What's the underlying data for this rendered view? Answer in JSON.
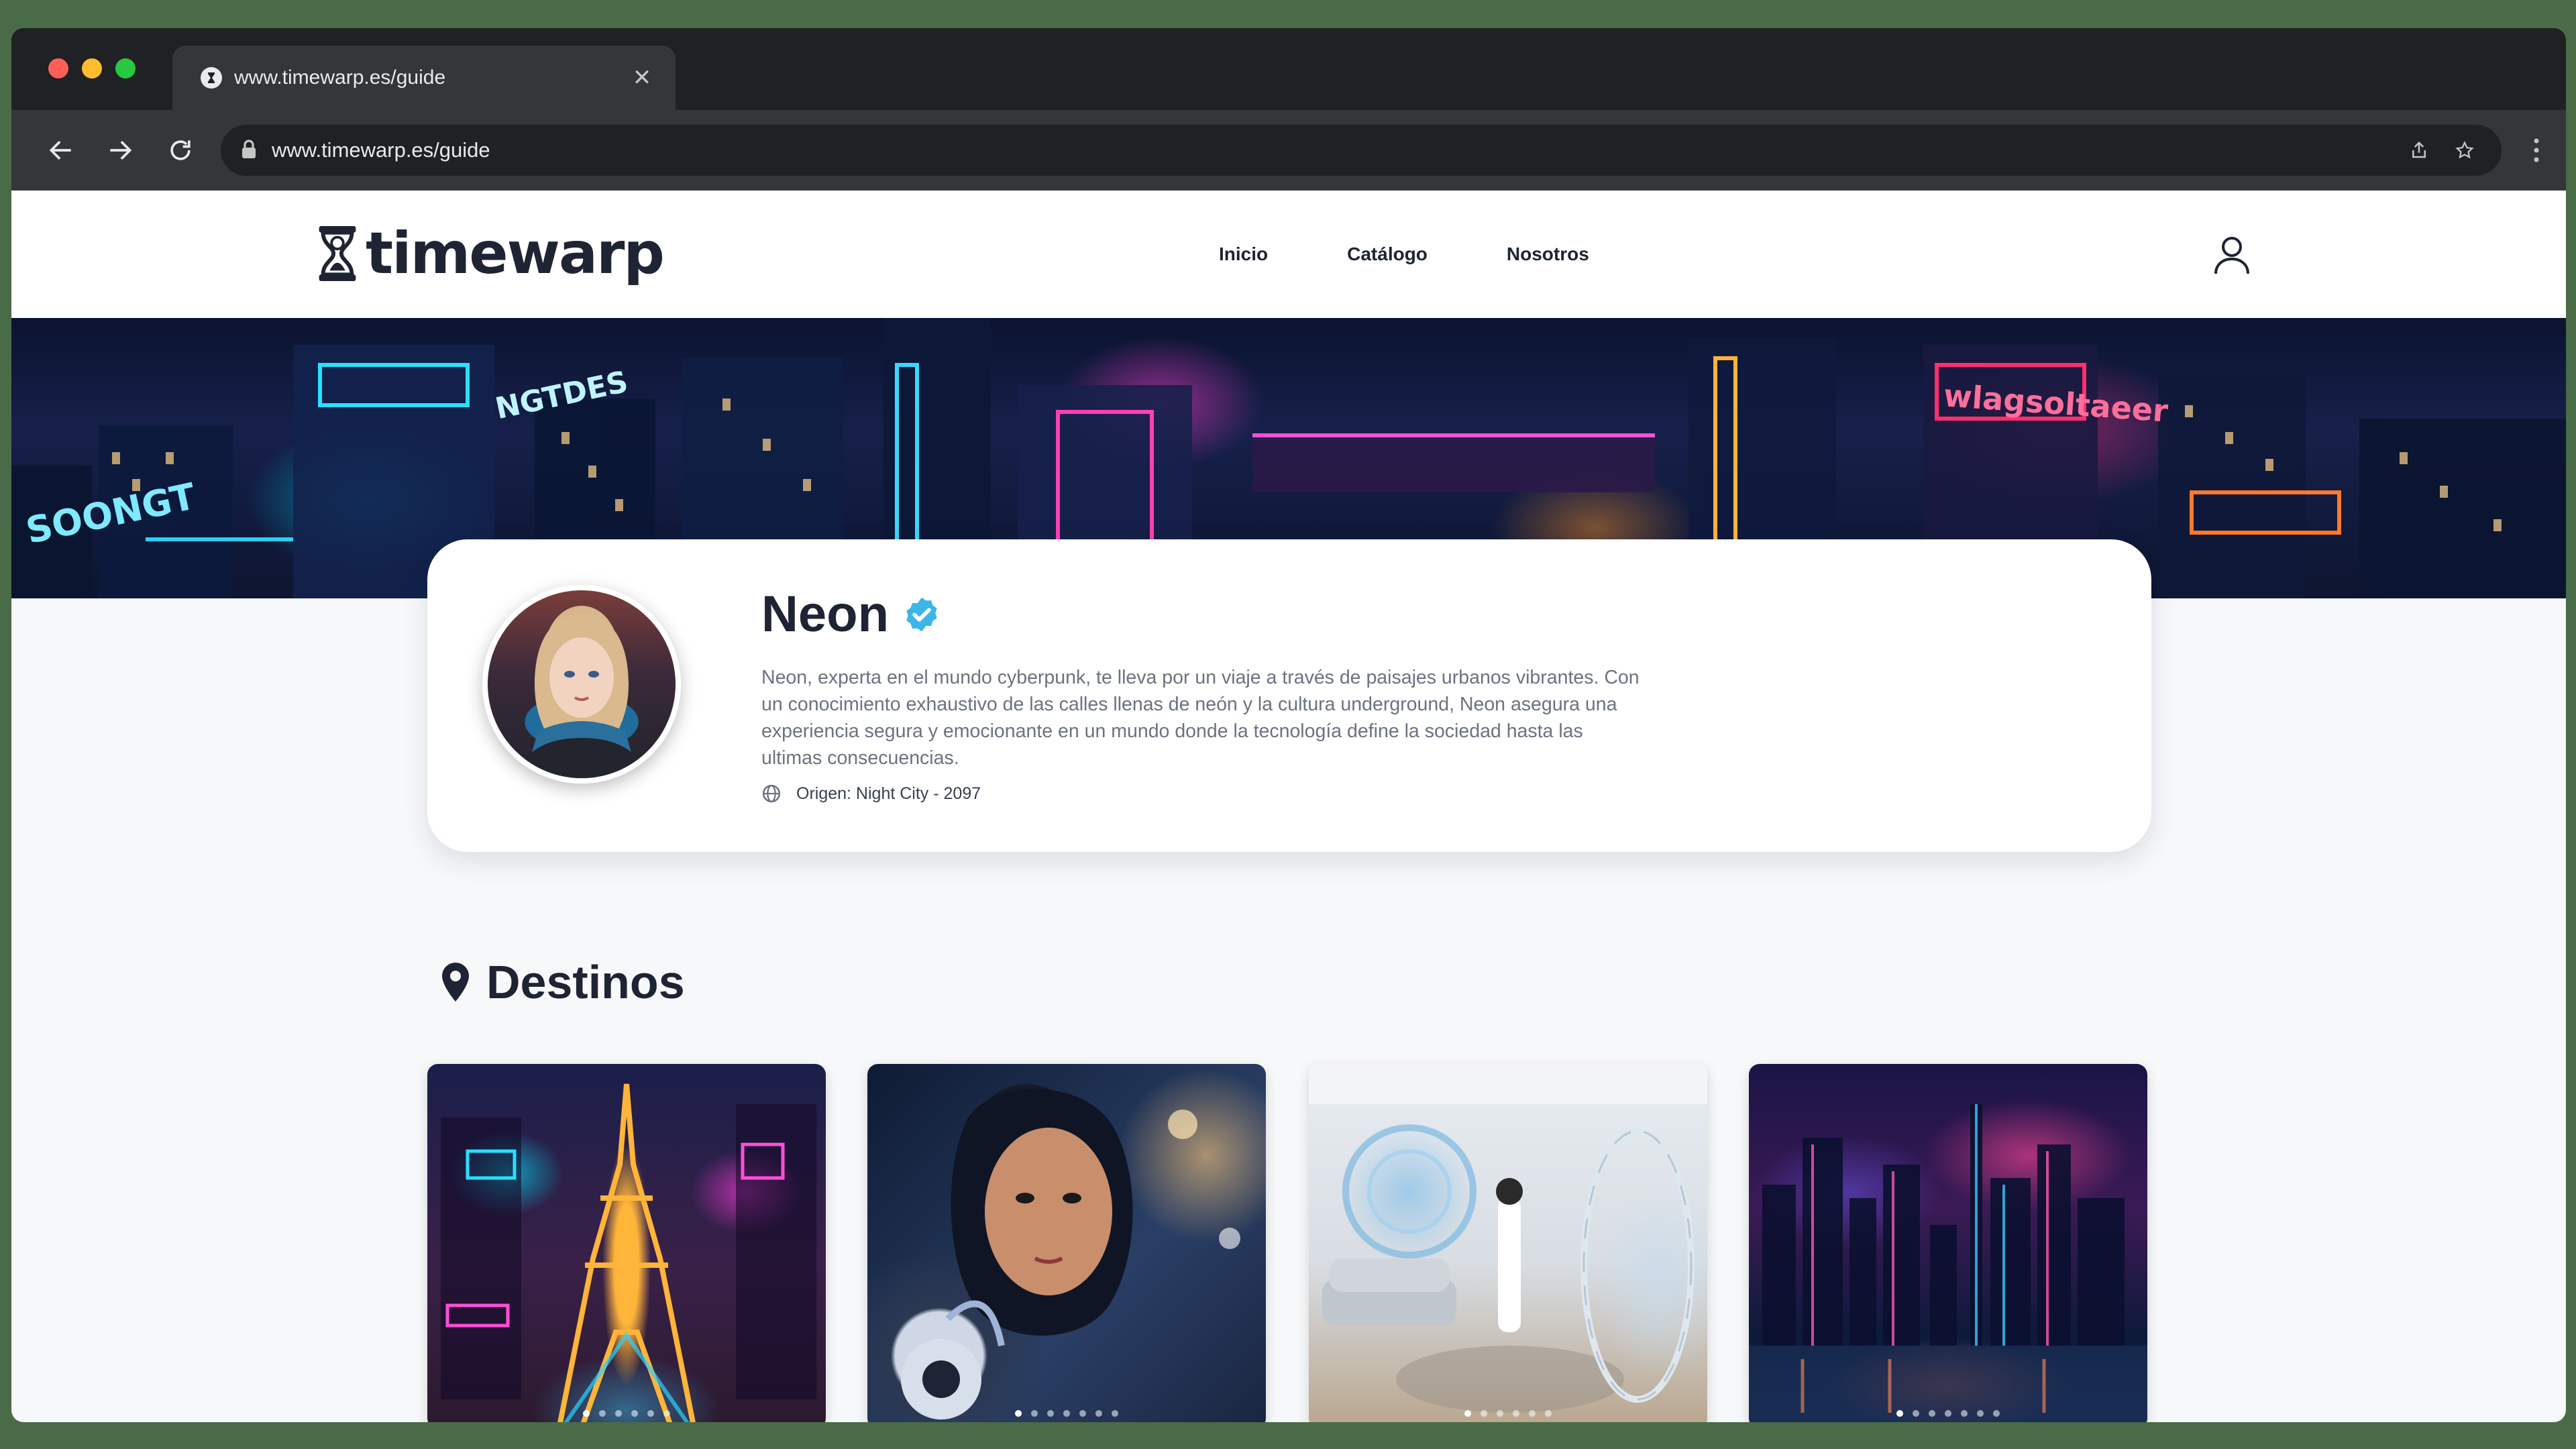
{
  "browser": {
    "tab_title": "www.timewarp.es/guide",
    "tab_close": "✕",
    "url": "www.timewarp.es/guide",
    "traffic_lights": [
      "#ff5f57",
      "#febc2e",
      "#28c840"
    ]
  },
  "site": {
    "logo_text": "timewarp",
    "nav": [
      "Inicio",
      "Catálogo",
      "Nosotros"
    ]
  },
  "hero": {
    "signs": [
      "SOONGT",
      "NGTDES",
      "wlagsoltaeer"
    ]
  },
  "guide": {
    "name": "Neon",
    "verified": true,
    "bio": "Neon, experta en el mundo cyberpunk, te lleva por un viaje a través de paisajes urbanos vibrantes. Con un conocimiento exhaustivo de las calles llenas de neón y la cultura underground, Neon asegura una experiencia segura y emocionante en un mundo donde la tecnología define la sociedad hasta las ultimas consecuencias.",
    "origin": "Origen: Night City - 2097"
  },
  "destinations": {
    "title": "Destinos",
    "cards": [
      {
        "image": "neon-paris-eiffel-tower",
        "dots": 6,
        "active_dot": 0
      },
      {
        "image": "cyborg-woman-portrait",
        "dots": 7,
        "active_dot": 0
      },
      {
        "image": "futuristic-apartment-interior",
        "dots": 6,
        "active_dot": 0
      },
      {
        "image": "neon-skyline-night",
        "dots": 7,
        "active_dot": 0
      }
    ]
  },
  "colors": {
    "brand_dark": "#1e2433",
    "verified_badge": "#3bb6e6",
    "page_bg": "#f7f8fa"
  }
}
